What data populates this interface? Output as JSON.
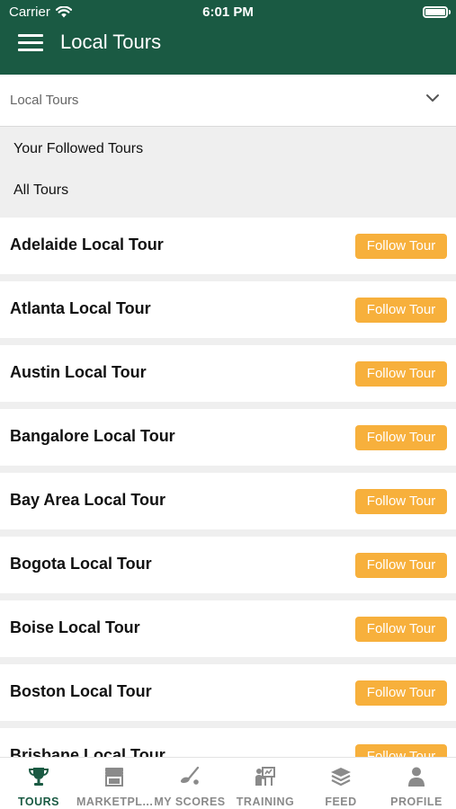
{
  "status_bar": {
    "carrier": "Carrier",
    "time": "6:01 PM"
  },
  "header": {
    "title": "Local Tours"
  },
  "dropdown": {
    "selected": "Local Tours"
  },
  "filter_options": [
    "Your Followed Tours",
    "All Tours"
  ],
  "tours": [
    {
      "name": "Adelaide Local Tour",
      "action": "Follow Tour"
    },
    {
      "name": "Atlanta Local Tour",
      "action": "Follow Tour"
    },
    {
      "name": "Austin Local Tour",
      "action": "Follow Tour"
    },
    {
      "name": "Bangalore Local Tour",
      "action": "Follow Tour"
    },
    {
      "name": "Bay Area Local Tour",
      "action": "Follow Tour"
    },
    {
      "name": "Bogota Local Tour",
      "action": "Follow Tour"
    },
    {
      "name": "Boise Local Tour",
      "action": "Follow Tour"
    },
    {
      "name": "Boston Local Tour",
      "action": "Follow Tour"
    },
    {
      "name": "Brisbane Local Tour",
      "action": "Follow Tour"
    }
  ],
  "tabs": [
    {
      "label": "TOURS",
      "icon": "trophy-icon",
      "active": true
    },
    {
      "label": "MARKETPL...",
      "icon": "store-icon",
      "active": false
    },
    {
      "label": "MY SCORES",
      "icon": "golf-club-icon",
      "active": false
    },
    {
      "label": "TRAINING",
      "icon": "training-icon",
      "active": false
    },
    {
      "label": "FEED",
      "icon": "layers-icon",
      "active": false
    },
    {
      "label": "PROFILE",
      "icon": "person-icon",
      "active": false
    }
  ],
  "colors": {
    "header": "#1a5a43",
    "follow_button": "#f7b03c",
    "active_tab": "#1a5a43",
    "inactive_tab": "#8a8a8a"
  }
}
